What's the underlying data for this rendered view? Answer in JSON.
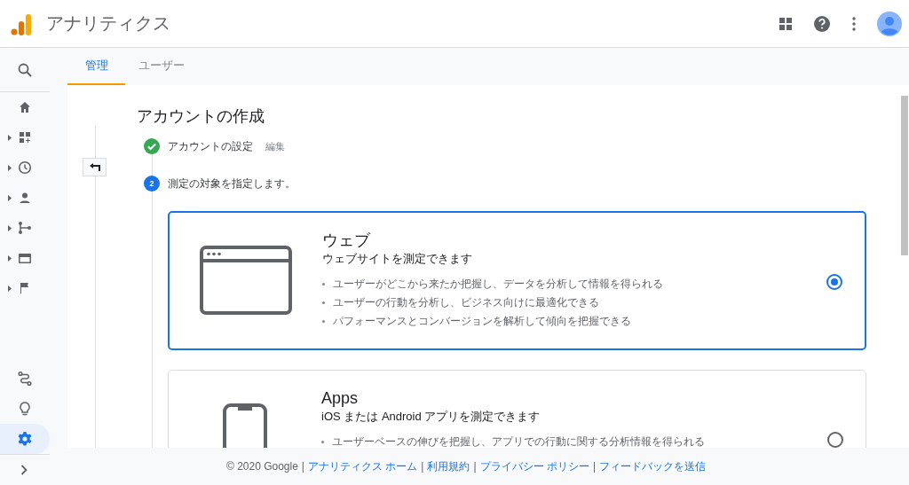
{
  "header": {
    "title": "アナリティクス"
  },
  "sidebar": {
    "top": [
      {
        "kind": "search",
        "expandable": false,
        "selected": false
      },
      {
        "kind": "home",
        "expandable": false,
        "selected": false
      },
      {
        "kind": "dashboard",
        "expandable": true,
        "selected": false
      },
      {
        "kind": "clock",
        "expandable": true,
        "selected": false
      },
      {
        "kind": "person",
        "expandable": true,
        "selected": false
      },
      {
        "kind": "flow",
        "expandable": true,
        "selected": false
      },
      {
        "kind": "card",
        "expandable": true,
        "selected": false
      },
      {
        "kind": "flag",
        "expandable": true,
        "selected": false
      }
    ],
    "bottom": [
      {
        "kind": "route",
        "expandable": false,
        "selected": false
      },
      {
        "kind": "bulb",
        "expandable": false,
        "selected": false
      },
      {
        "kind": "gear",
        "expandable": false,
        "selected": true
      }
    ]
  },
  "tabs": [
    {
      "label": "管理",
      "selected": true
    },
    {
      "label": "ユーザー",
      "selected": false
    }
  ],
  "page_title": "アカウントの作成",
  "steps": [
    {
      "kind": "done",
      "label": "アカウントの設定",
      "action": "編集"
    },
    {
      "kind": "current",
      "number": "2",
      "label": "測定の対象を指定します。"
    }
  ],
  "options": [
    {
      "kind": "web",
      "title": "ウェブ",
      "subtitle": "ウェブサイトを測定できます",
      "selected": true,
      "bullets": [
        "ユーザーがどこから来たか把握し、データを分析して情報を得られる",
        "ユーザーの行動を分析し、ビジネス向けに最適化できる",
        "パフォーマンスとコンバージョンを解析して傾向を把握できる"
      ]
    },
    {
      "kind": "app",
      "title": "Apps",
      "subtitle": "iOS または Android アプリを測定できます",
      "selected": false,
      "bullets": [
        "ユーザーベースの伸びを把握し、アプリでの行動に関する分析情報を得られる"
      ]
    }
  ],
  "footer": [
    {
      "kind": "text",
      "text": "© 2020 Google"
    },
    {
      "kind": "separator",
      "text": "|"
    },
    {
      "kind": "link",
      "text": "アナリティクス ホーム"
    },
    {
      "kind": "separator",
      "text": "|"
    },
    {
      "kind": "link",
      "text": "利用規約"
    },
    {
      "kind": "separator",
      "text": "|"
    },
    {
      "kind": "link",
      "text": "プライバシー ポリシー"
    },
    {
      "kind": "separator",
      "text": "|"
    },
    {
      "kind": "link",
      "text": "フィードバックを送信"
    }
  ]
}
